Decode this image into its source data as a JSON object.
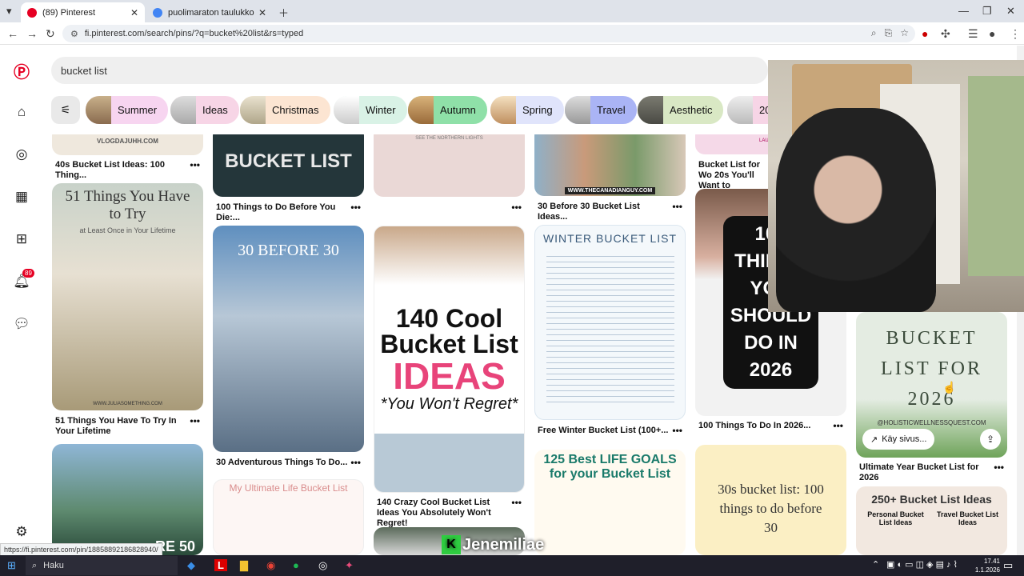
{
  "browser": {
    "tabs": [
      {
        "title": "(89) Pinterest",
        "favicon_color": "#e60023"
      },
      {
        "title": "puolimaraton taulukko - Googl",
        "favicon_color": "#4285f4"
      }
    ],
    "url": "fi.pinterest.com/search/pins/?q=bucket%20list&rs=typed",
    "status_url": "https://fi.pinterest.com/pin/18858892186828940/"
  },
  "pinterest": {
    "notifications_badge": "89",
    "search_value": "bucket list",
    "chips": [
      {
        "label": "Summer",
        "color": "#f7d5f0"
      },
      {
        "label": "Ideas",
        "color": "#f7d5e6"
      },
      {
        "label": "Christmas",
        "color": "#fce5d2"
      },
      {
        "label": "Winter",
        "color": "#d9f2e6"
      },
      {
        "label": "Autumn",
        "color": "#8fe0a8"
      },
      {
        "label": "Spring",
        "color": "#e0e4fb"
      },
      {
        "label": "Travel",
        "color": "#aab4f5"
      },
      {
        "label": "Aesthetic",
        "color": "#d9e8c4"
      },
      {
        "label": "20",
        "color": "#f7d5e6"
      }
    ],
    "pins": [
      {
        "title": "40s Bucket List Ideas: 100 Thing...",
        "img_text": "VLOGDAJUHH.COM"
      },
      {
        "title": "51 Things You Have To Try In Your Lifetime",
        "img_text": "51 Things You Have to Try",
        "img_sub": "at Least Once in Your Lifetime",
        "img_footer": "WWW.JULIASOMETHING.COM"
      },
      {
        "title": "",
        "img_text": "RE 50"
      },
      {
        "title": "100 Things to Do Before You Die:...",
        "img_text": "BUCKET LIST"
      },
      {
        "title": "30 Adventurous Things To Do...",
        "img_text": "30 BEFORE 30"
      },
      {
        "title": "",
        "img_text": "My Ultimate Life Bucket List"
      },
      {
        "title": "",
        "img_text": "SEE THE NORTHERN LIGHTS"
      },
      {
        "title": "140 Crazy Cool Bucket List Ideas You Absolutely Won't Regret!",
        "img_text": "140 Cool Bucket List",
        "img_big": "IDEAS",
        "img_sub": "*You Won't Regret*"
      },
      {
        "title": "30 Before 30 Bucket List Ideas...",
        "img_text": "WWW.THECANADIANGUY.COM"
      },
      {
        "title": "Free Winter Bucket List (100+...",
        "img_text": "WINTER BUCKET LIST"
      },
      {
        "title": "",
        "img_text": "125 Best LIFE GOALS for your Bucket List"
      },
      {
        "title": "Bucket List for Wo 20s You'll Want to",
        "img_text": "LAURACO"
      },
      {
        "title": "100 Things To Do In 2026...",
        "img_text": "100 THINGS YOU SHOULD DO IN 2026"
      },
      {
        "title": "",
        "img_text": "30s bucket list: 100 things to do before 30"
      },
      {
        "title": "Ultimate Year Bucket List for 2026",
        "img_text": "BUCKET LIST FOR 2026",
        "img_footer": "@HOLISTICWELLNESSQUEST.COM",
        "visit_label": "Käy sivus..."
      },
      {
        "title": "",
        "img_text": "250+ Bucket List Ideas",
        "img_sub": "Personal Bucket List Ideas",
        "img_sub2": "Travel Bucket List Ideas"
      }
    ]
  },
  "overlay": {
    "watermark": "Jenemiliae"
  },
  "taskbar": {
    "search_label": "Haku",
    "time": "17.41",
    "date": "1.1.2026"
  },
  "colors": {
    "pinterest_red": "#e60023"
  }
}
